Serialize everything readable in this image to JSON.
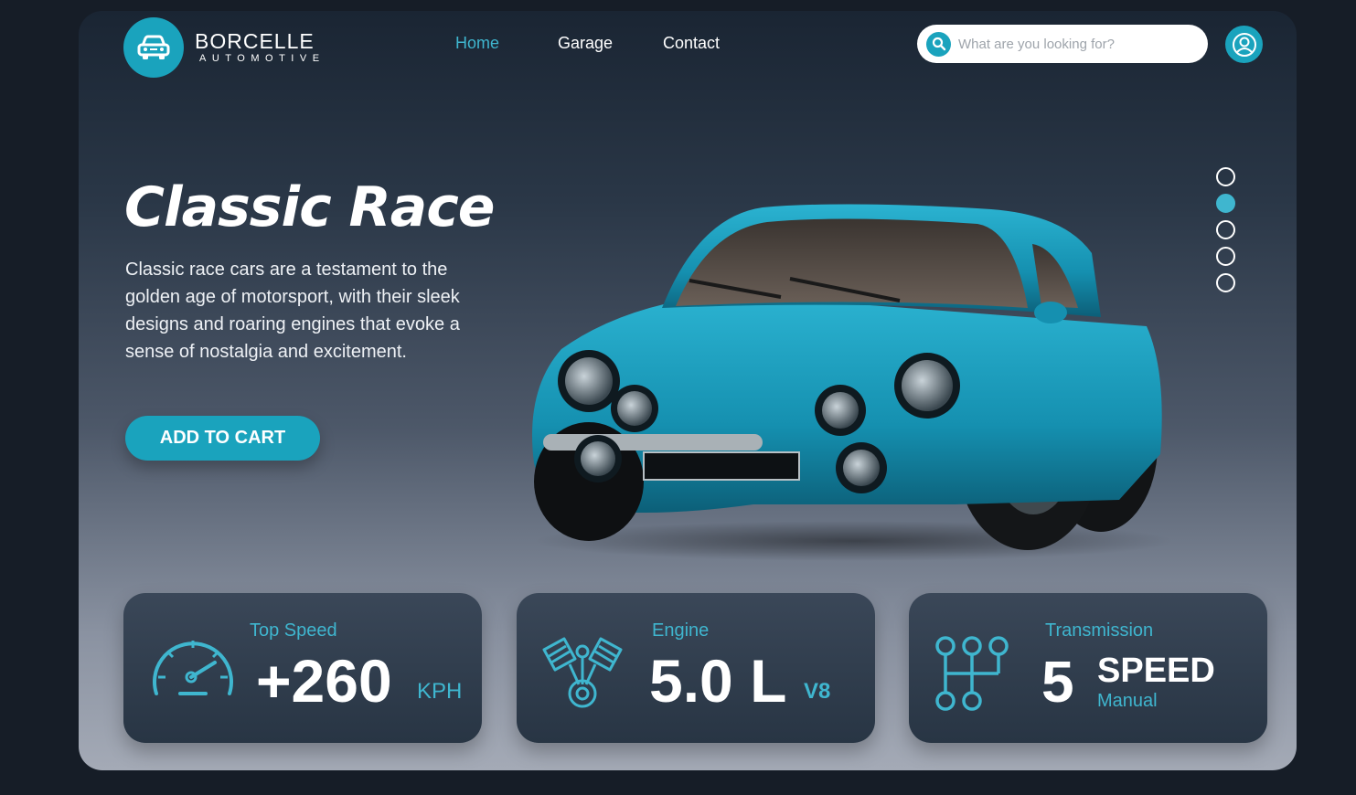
{
  "brand": {
    "name": "BORCELLE",
    "tagline": "AUTOMOTIVE",
    "logo_icon": "car-front-icon"
  },
  "nav": [
    {
      "label": "Home",
      "active": true
    },
    {
      "label": "Garage",
      "active": false
    },
    {
      "label": "Contact",
      "active": false
    }
  ],
  "search": {
    "placeholder": "What are you looking for?",
    "icon": "search-icon"
  },
  "user": {
    "icon": "user-icon"
  },
  "hero": {
    "title": "Classic Race",
    "description": "Classic race cars are a testament to the golden age of motorsport, with their sleek designs and roaring engines that evoke a sense of nostalgia and excitement.",
    "cta_label": "ADD TO CART"
  },
  "carousel": {
    "total": 5,
    "active_index": 1
  },
  "stats": [
    {
      "label": "Top Speed",
      "value": "+260",
      "unit": "KPH",
      "icon": "speedometer-icon"
    },
    {
      "label": "Engine",
      "value": "5.0 L",
      "unit": "V8",
      "icon": "engine-icon"
    },
    {
      "label": "Transmission",
      "value": "5",
      "unit": "SPEED",
      "sub": "Manual",
      "icon": "gear-shift-icon"
    }
  ],
  "colors": {
    "accent": "#1aa3bd",
    "accent_light": "#3fb6cf",
    "car_body": "#1b8fb0",
    "background": "#161d27"
  }
}
